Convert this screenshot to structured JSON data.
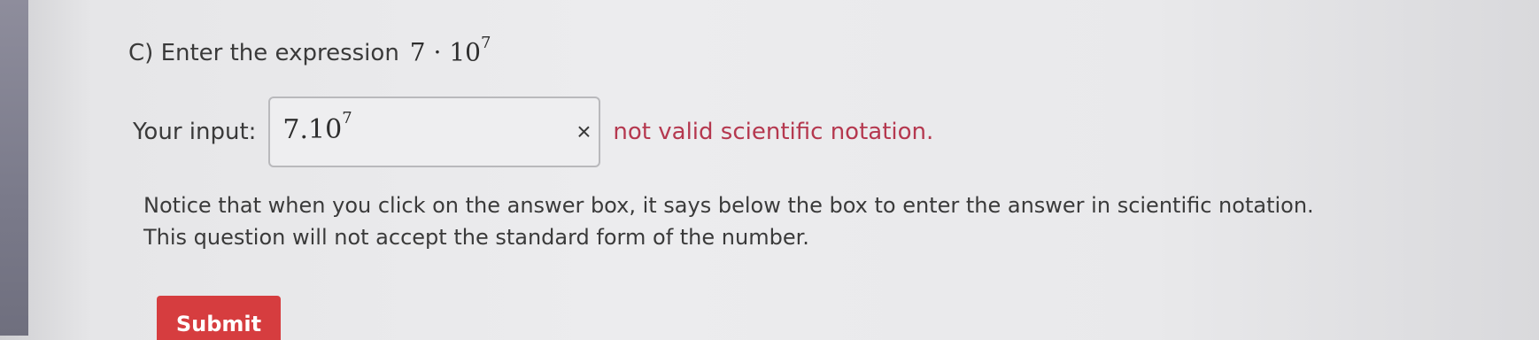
{
  "question": {
    "prefix": "C) Enter the expression",
    "base": "7 · 10",
    "exponent": "7"
  },
  "answer": {
    "label": "Your input:",
    "value_base": "7.10",
    "value_exponent": "7",
    "clear_icon": "×",
    "error": "not valid scientific notation."
  },
  "notice": {
    "line1": "Notice that when you click on the answer box, it says below the box to enter the answer in scientific notation.",
    "line2": "This question will not accept the standard form of the number."
  },
  "submit": {
    "label": "Submit",
    "color": "#d63d3f"
  },
  "colors": {
    "error": "#b5384f"
  }
}
